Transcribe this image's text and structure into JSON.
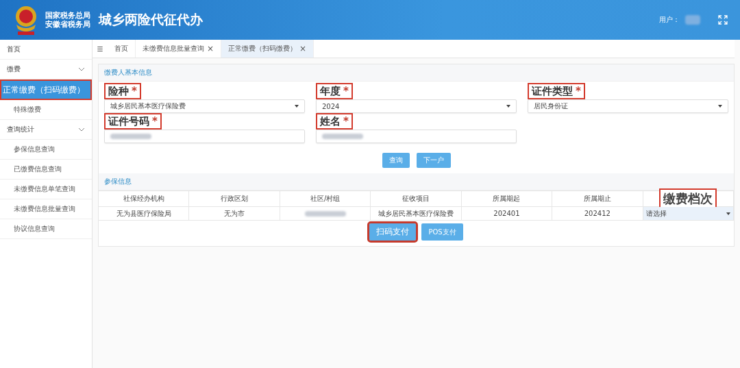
{
  "header": {
    "org_lines": [
      "国家税务总局",
      "安徽省税务局"
    ],
    "title": "城乡两险代征代办",
    "user_label": "用户："
  },
  "sidebar": {
    "items": [
      {
        "label": "首页",
        "kind": "link",
        "selected": false,
        "outlined": false
      },
      {
        "label": "缴费",
        "kind": "group",
        "expanded": true,
        "children": [
          {
            "label": "正常缴费（扫码缴费）",
            "kind": "link",
            "selected": true,
            "outlined": true
          },
          {
            "label": "特殊缴费",
            "kind": "link",
            "selected": false,
            "outlined": false
          }
        ]
      },
      {
        "label": "查询统计",
        "kind": "group",
        "expanded": true,
        "children": [
          {
            "label": "参保信息查询",
            "kind": "link",
            "selected": false,
            "outlined": false
          },
          {
            "label": "已缴费信息查询",
            "kind": "link",
            "selected": false,
            "outlined": false
          },
          {
            "label": "未缴费信息单笔查询",
            "kind": "link",
            "selected": false,
            "outlined": false
          },
          {
            "label": "未缴费信息批量查询",
            "kind": "link",
            "selected": false,
            "outlined": false
          },
          {
            "label": "协议信息查询",
            "kind": "link",
            "selected": false,
            "outlined": false
          }
        ]
      }
    ]
  },
  "tabs": {
    "menu": "☰",
    "items": [
      {
        "label": "首页",
        "selected": false
      },
      {
        "label": "未缴费信息批量查询",
        "close": "×",
        "selected": false
      },
      {
        "label": "正常缴费（扫码缴费）",
        "close": "×",
        "selected": true
      }
    ]
  },
  "basic_info": {
    "heading": "缴费人基本信息",
    "fields": [
      {
        "label": "险种",
        "required_mark": "*",
        "kind": "select",
        "value": "城乡居民基本医疗保险费",
        "outlined": true
      },
      {
        "label": "年度",
        "required_mark": "*",
        "kind": "select",
        "value": "2024",
        "outlined": true
      },
      {
        "label": "证件类型",
        "required_mark": "*",
        "kind": "select",
        "value": "居民身份证",
        "outlined": true
      },
      {
        "label": "证件号码",
        "required_mark": "*",
        "kind": "blurred",
        "outlined": true
      },
      {
        "label": "姓名",
        "required_mark": "*",
        "kind": "blurred",
        "outlined": true
      }
    ],
    "buttons": [
      "查询",
      "下一户"
    ]
  },
  "insured_info": {
    "heading": "参保信息",
    "table": {
      "columns": [
        {
          "label": "社保经办机构",
          "outlined": false
        },
        {
          "label": "行政区划",
          "outlined": false
        },
        {
          "label": "社区/村组",
          "outlined": false
        },
        {
          "label": "征收项目",
          "outlined": false
        },
        {
          "label": "所属期起",
          "outlined": false
        },
        {
          "label": "所属期止",
          "outlined": false
        },
        {
          "label": "缴费档次",
          "outlined": true
        }
      ],
      "rows": [
        [
          {
            "kind": "text",
            "text": "无为县医疗保险局"
          },
          {
            "kind": "text",
            "text": "无为市"
          },
          {
            "kind": "blurred"
          },
          {
            "kind": "text",
            "text": "城乡居民基本医疗保险费"
          },
          {
            "kind": "text",
            "text": "202401"
          },
          {
            "kind": "text",
            "text": "202412"
          },
          {
            "kind": "select",
            "text": "请选择"
          }
        ]
      ]
    },
    "buttons": [
      {
        "label": "扫码支付",
        "outlined": true
      },
      {
        "label": "POS支付",
        "outlined": false
      }
    ]
  }
}
